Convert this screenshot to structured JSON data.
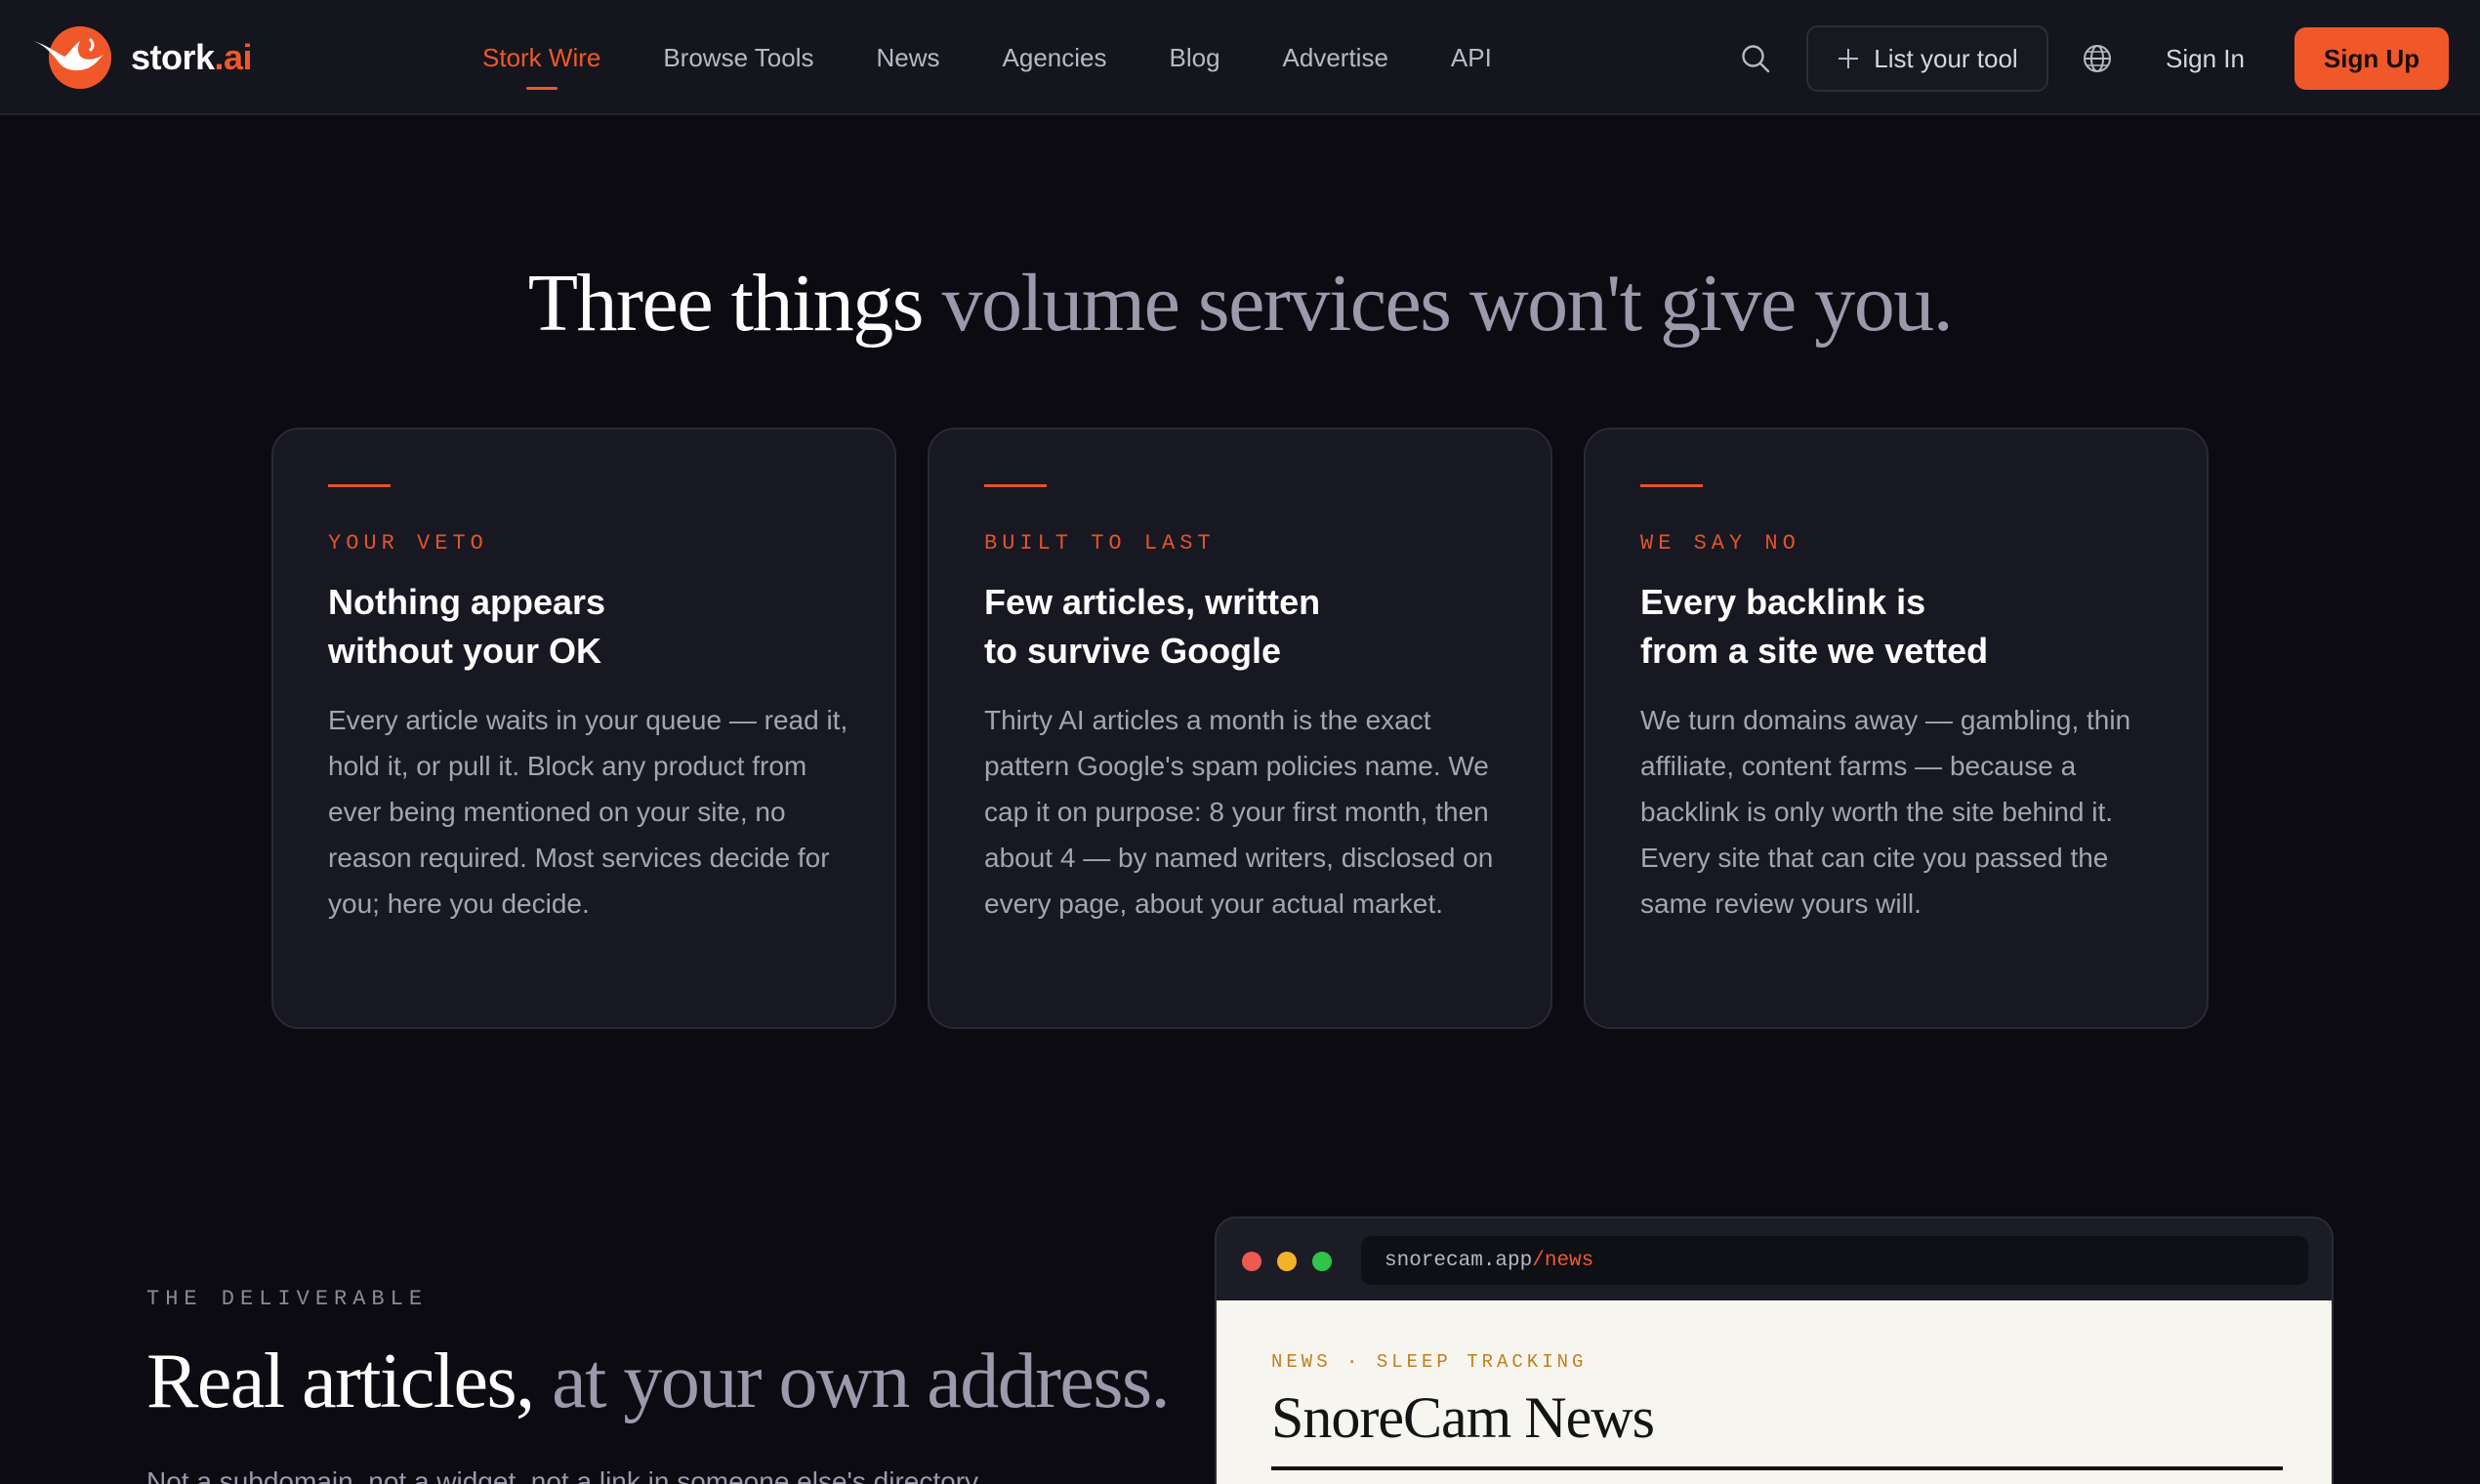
{
  "header": {
    "logo": {
      "name": "stork",
      "tld": ".ai"
    },
    "nav": [
      {
        "label": "Stork Wire",
        "active": true
      },
      {
        "label": "Browse Tools",
        "active": false
      },
      {
        "label": "News",
        "active": false
      },
      {
        "label": "Agencies",
        "active": false
      },
      {
        "label": "Blog",
        "active": false
      },
      {
        "label": "Advertise",
        "active": false
      },
      {
        "label": "API",
        "active": false
      }
    ],
    "search_icon": "search-icon",
    "list_tool_label": "List your tool",
    "globe_icon": "globe-icon",
    "sign_in_label": "Sign In",
    "sign_up_label": "Sign Up"
  },
  "section_promise": {
    "headline_strong": "Three things",
    "headline_muted": "volume services won't give you.",
    "cards": [
      {
        "eyebrow": "YOUR VETO",
        "title": "Nothing appears\nwithout your OK",
        "body": "Every article waits in your queue — read it, hold it, or pull it. Block any product from ever being mentioned on your site, no reason required. Most services decide for you; here you decide."
      },
      {
        "eyebrow": "BUILT TO LAST",
        "title": "Few articles, written\nto survive Google",
        "body": "Thirty AI articles a month is the exact pattern Google's spam policies name. We cap it on purpose: 8 your first month, then about 4 — by named writers, disclosed on every page, about your actual market."
      },
      {
        "eyebrow": "WE SAY NO",
        "title": "Every backlink is\nfrom a site we vetted",
        "body": "We turn domains away — gambling, thin affiliate, content farms — because a backlink is only worth the site behind it. Every site that can cite you passed the same review yours will."
      }
    ]
  },
  "section_deliverable": {
    "eyebrow": "THE DELIVERABLE",
    "title_strong": "Real articles,",
    "title_muted": "at your own address.",
    "text_partial": "Not a subdomain, not a widget, not a link in someone else's directory."
  },
  "browser_preview": {
    "url_host": "snorecam.app",
    "url_path": "/news",
    "page_eyebrow": "NEWS · SLEEP TRACKING",
    "page_title": "SnoreCam News"
  },
  "colors": {
    "accent": "#f0582a",
    "background": "#0b0b11",
    "card": "#181822",
    "header": "#15151d",
    "eyebrow_gold": "#c0801e"
  }
}
